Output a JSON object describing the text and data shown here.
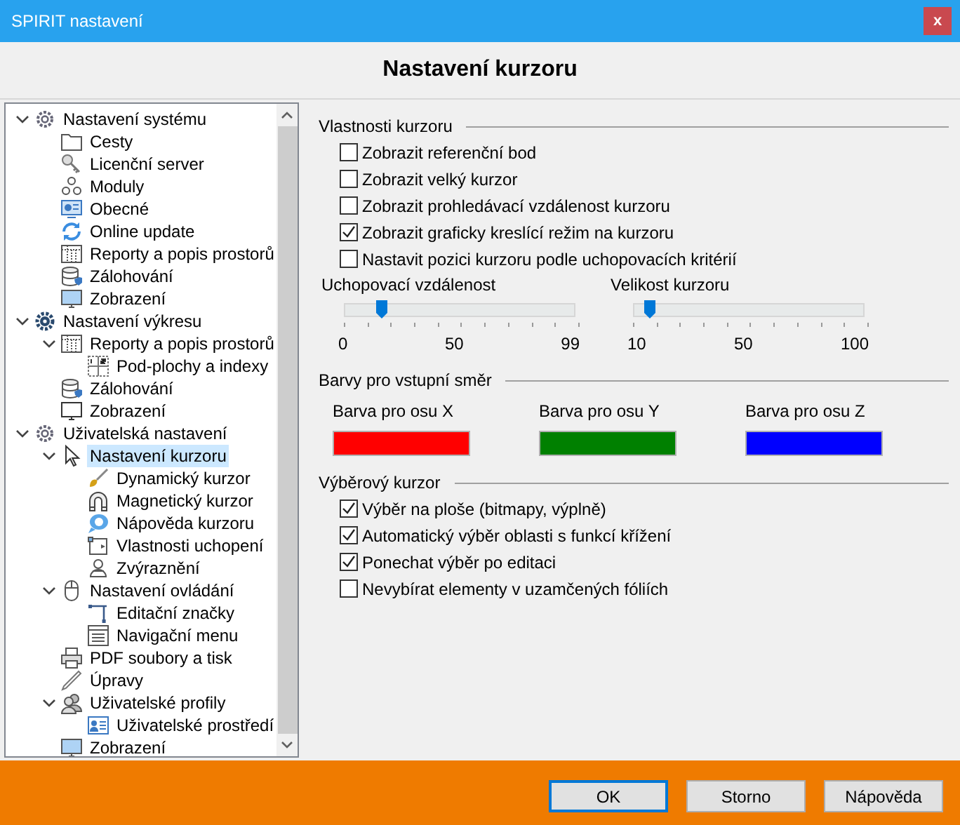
{
  "window": {
    "title": "SPIRIT nastavení",
    "close": "x"
  },
  "header": {
    "title": "Nastavení kurzoru"
  },
  "tree": [
    {
      "label": "Nastavení systému",
      "kind": "gear",
      "expanded": true,
      "selected": false,
      "children": [
        {
          "label": "Cesty",
          "kind": "folder",
          "selected": false
        },
        {
          "label": "Licenční server",
          "kind": "key",
          "selected": false
        },
        {
          "label": "Moduly",
          "kind": "modules",
          "selected": false
        },
        {
          "label": "Obecné",
          "kind": "general",
          "selected": false
        },
        {
          "label": "Online update",
          "kind": "update",
          "selected": false
        },
        {
          "label": "Reporty a popis prostorů",
          "kind": "table",
          "selected": false
        },
        {
          "label": "Zálohování",
          "kind": "database",
          "selected": false
        },
        {
          "label": "Zobrazení",
          "kind": "monitor",
          "selected": false
        }
      ]
    },
    {
      "label": "Nastavení výkresu",
      "kind": "gear_dark",
      "expanded": true,
      "selected": false,
      "children": [
        {
          "label": "Reporty a popis prostorů",
          "kind": "table",
          "expanded": true,
          "selected": false,
          "children": [
            {
              "label": "Pod-plochy a indexy",
              "kind": "grid",
              "selected": false
            }
          ]
        },
        {
          "label": "Zálohování",
          "kind": "database",
          "selected": false
        },
        {
          "label": "Zobrazení",
          "kind": "monitor_outline",
          "selected": false
        }
      ]
    },
    {
      "label": "Uživatelská nastavení",
      "kind": "gear",
      "expanded": true,
      "selected": false,
      "children": [
        {
          "label": "Nastavení kurzoru",
          "kind": "cursor",
          "expanded": true,
          "selected": true,
          "children": [
            {
              "label": "Dynamický kurzor",
              "kind": "brush",
              "selected": false
            },
            {
              "label": "Magnetický kurzor",
              "kind": "magnet",
              "selected": false
            },
            {
              "label": "Nápověda kurzoru",
              "kind": "help",
              "selected": false
            },
            {
              "label": "Vlastnosti uchopení",
              "kind": "snap",
              "selected": false
            },
            {
              "label": "Zvýraznění",
              "kind": "highlight",
              "selected": false
            }
          ]
        },
        {
          "label": "Nastavení ovládání",
          "kind": "mouse",
          "expanded": true,
          "selected": false,
          "children": [
            {
              "label": "Editační značky",
              "kind": "marks",
              "selected": false
            },
            {
              "label": "Navigační menu",
              "kind": "menu",
              "selected": false
            }
          ]
        },
        {
          "label": "PDF soubory a tisk",
          "kind": "printer",
          "selected": false
        },
        {
          "label": "Úpravy",
          "kind": "pencil",
          "selected": false
        },
        {
          "label": "Uživatelské profily",
          "kind": "users",
          "expanded": true,
          "selected": false,
          "children": [
            {
              "label": "Uživatelské prostředí",
              "kind": "profile",
              "selected": false
            }
          ]
        },
        {
          "label": "Zobrazení",
          "kind": "monitor",
          "selected": false
        }
      ]
    }
  ],
  "cursor_properties": {
    "title": "Vlastnosti kurzoru",
    "options": [
      {
        "label": "Zobrazit referenční bod",
        "checked": false
      },
      {
        "label": "Zobrazit velký kurzor",
        "checked": false
      },
      {
        "label": "Zobrazit prohledávací vzdálenost kurzoru",
        "checked": false
      },
      {
        "label": "Zobrazit graficky kreslící režim na kurzoru",
        "checked": true
      },
      {
        "label": "Nastavit pozici kurzoru podle uchopovacích kritérií",
        "checked": false
      }
    ],
    "sliders": [
      {
        "label": "Uchopovací vzdálenost",
        "level": 0.16,
        "ticks": [
          "0",
          "50",
          "99"
        ]
      },
      {
        "label": "Velikost kurzoru",
        "level": 0.07,
        "ticks": [
          "10",
          "50",
          "100"
        ]
      }
    ]
  },
  "direction_colors": {
    "title": "Barvy pro vstupní směr",
    "items": [
      {
        "label": "Barva pro osu X",
        "color": "#ff0000"
      },
      {
        "label": "Barva pro osu Y",
        "color": "#008000"
      },
      {
        "label": "Barva pro osu Z",
        "color": "#0000ff"
      }
    ]
  },
  "selection_cursor": {
    "title": "Výběrový kurzor",
    "options": [
      {
        "label": "Výběr na ploše (bitmapy, výplně)",
        "checked": true
      },
      {
        "label": "Automatický výběr oblasti s funkcí křížení",
        "checked": true
      },
      {
        "label": "Ponechat výběr po editaci",
        "checked": true
      },
      {
        "label": "Nevybírat elementy v uzamčených fóliích",
        "checked": false
      }
    ]
  },
  "buttons": [
    {
      "label": "OK",
      "selected": true
    },
    {
      "label": "Storno",
      "selected": false
    },
    {
      "label": "Nápověda",
      "selected": false
    }
  ]
}
